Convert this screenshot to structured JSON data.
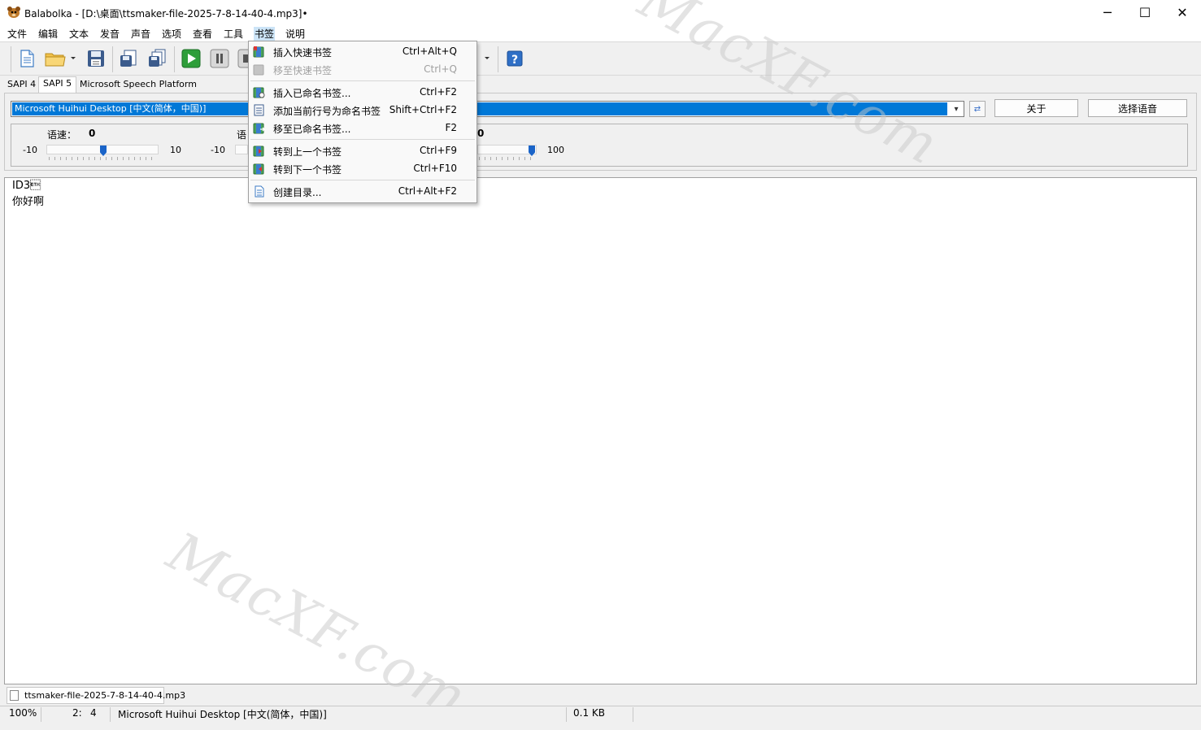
{
  "window": {
    "title": "Balabolka - [D:\\桌面\\ttsmaker-file-2025-7-8-14-40-4.mp3]•",
    "minimize": "─",
    "maximize": "☐",
    "close": "✕"
  },
  "menubar": [
    "文件",
    "编辑",
    "文本",
    "发音",
    "声音",
    "选项",
    "查看",
    "工具",
    "书签",
    "说明"
  ],
  "engine_tabs": [
    "SAPI 4",
    "SAPI 5",
    "Microsoft Speech Platform"
  ],
  "voice": {
    "selected": "Microsoft Huihui Desktop [中文(简体，中国)]",
    "about_button": "关于",
    "select_button": "选择语音"
  },
  "sliders": {
    "rate": {
      "label": "语速：",
      "value": "0",
      "min": "-10",
      "max": "10",
      "level": 0.5
    },
    "pitch": {
      "label": "语",
      "min": "-10"
    },
    "volume": {
      "value": "0",
      "max": "100",
      "level": 1.0
    }
  },
  "editor": {
    "lines": [
      "ID3\u0003",
      "你好啊"
    ]
  },
  "doc_tab": "ttsmaker-file-2025-7-8-14-40-4.mp3",
  "status": {
    "zoom": "100%",
    "line": "2:",
    "col": "4",
    "voice": "Microsoft Huihui Desktop [中文(简体，中国)]",
    "size": "0.1 KB"
  },
  "bookmark_menu": [
    {
      "label": "插入快速书签",
      "shortcut": "Ctrl+Alt+Q",
      "disabled": false
    },
    {
      "label": "移至快速书签",
      "shortcut": "Ctrl+Q",
      "disabled": true
    },
    {
      "label": "插入已命名书签...",
      "shortcut": "Ctrl+F2",
      "disabled": false
    },
    {
      "label": "添加当前行号为命名书签",
      "shortcut": "Shift+Ctrl+F2",
      "disabled": false
    },
    {
      "label": "移至已命名书签...",
      "shortcut": "F2",
      "disabled": false
    },
    {
      "label": "转到上一个书签",
      "shortcut": "Ctrl+F9",
      "disabled": false
    },
    {
      "label": "转到下一个书签",
      "shortcut": "Ctrl+F10",
      "disabled": false
    },
    {
      "label": "创建目录...",
      "shortcut": "Ctrl+Alt+F2",
      "disabled": false
    }
  ],
  "watermark": "MacXF.com",
  "colors": {
    "accent": "#0078d7",
    "menu_highlight": "#cce4f7",
    "play_green": "#2e9e3a",
    "slider_thumb": "#1a64c8"
  }
}
